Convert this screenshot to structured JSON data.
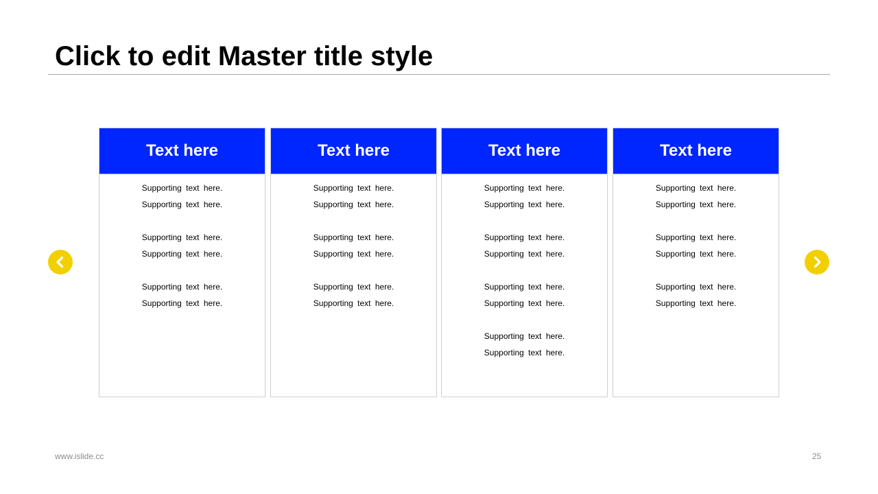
{
  "slide": {
    "title": "Click to edit Master title style",
    "footer_url": "www.islide.cc",
    "page_number": "25"
  },
  "cards": [
    {
      "header": "Text here",
      "groups": [
        [
          "Supporting text here.",
          "Supporting text here."
        ],
        [
          "Supporting text here.",
          "Supporting text here."
        ],
        [
          "Supporting text here.",
          "Supporting text here."
        ]
      ]
    },
    {
      "header": "Text here",
      "groups": [
        [
          "Supporting text here.",
          "Supporting text here."
        ],
        [
          "Supporting text here.",
          "Supporting text here."
        ],
        [
          "Supporting text here.",
          "Supporting text here."
        ]
      ]
    },
    {
      "header": "Text here",
      "groups": [
        [
          "Supporting text here.",
          "Supporting text here."
        ],
        [
          "Supporting text here.",
          "Supporting text here."
        ],
        [
          "Supporting text here.",
          "Supporting text here."
        ],
        [
          "Supporting text here.",
          "Supporting text here."
        ]
      ]
    },
    {
      "header": "Text here",
      "groups": [
        [
          "Supporting text here.",
          "Supporting text here."
        ],
        [
          "Supporting text here.",
          "Supporting text here."
        ],
        [
          "Supporting text here.",
          "Supporting text here."
        ]
      ]
    }
  ],
  "navigation": {
    "prev_icon": "chevron-left-icon",
    "next_icon": "chevron-right-icon"
  },
  "colors": {
    "card_header": "#0026ff",
    "nav_button": "#f2d000",
    "title_rule": "#a6a6a6"
  }
}
